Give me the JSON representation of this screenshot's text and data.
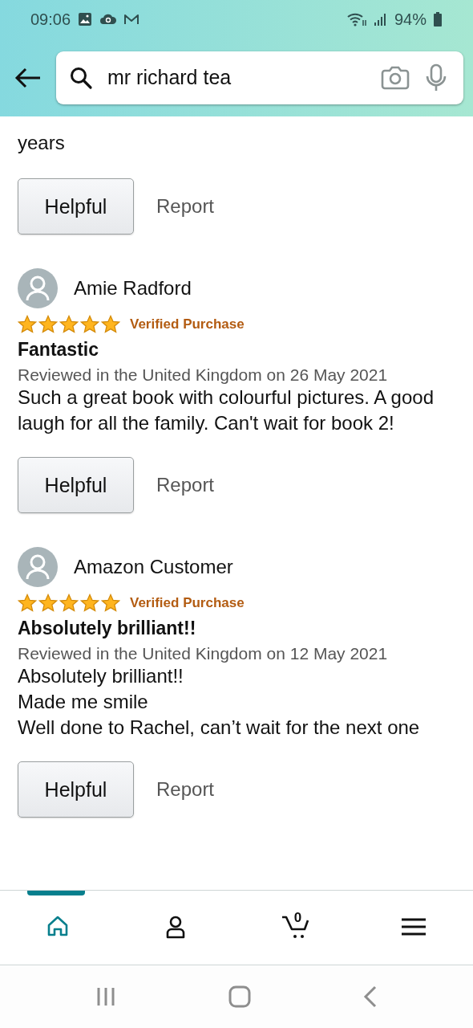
{
  "status_bar": {
    "time": "09:06",
    "battery": "94%"
  },
  "search": {
    "value": "mr richard tea"
  },
  "partial_review": {
    "lines": [
      "years"
    ],
    "buttons": [
      "Helpful",
      "Report"
    ]
  },
  "reviews": [
    {
      "name": "Amie Radford",
      "stars": 5,
      "badge": "Verified Purchase",
      "title": "Fantastic",
      "meta": "Reviewed in the United Kingdom on 26 May 2021",
      "lines": [
        "Such a great book with colourful pictures. A good laugh for all the family. Can't wait for book 2!"
      ],
      "buttons": [
        "Helpful",
        "Report"
      ]
    },
    {
      "name": "Amazon Customer",
      "stars": 5,
      "badge": "Verified Purchase",
      "title": "Absolutely brilliant!!",
      "meta": "Reviewed in the United Kingdom on 12 May 2021",
      "lines": [
        "Absolutely brilliant!!",
        "Made me smile",
        "Well done to Rachel, can’t wait for the next one"
      ],
      "buttons": [
        "Helpful",
        "Report"
      ]
    }
  ],
  "bottom_nav": [
    {
      "kind": "home",
      "selected": true
    },
    {
      "kind": "account",
      "selected": false
    },
    {
      "kind": "cart",
      "selected": false,
      "count": "0"
    },
    {
      "kind": "menu",
      "selected": false
    }
  ]
}
